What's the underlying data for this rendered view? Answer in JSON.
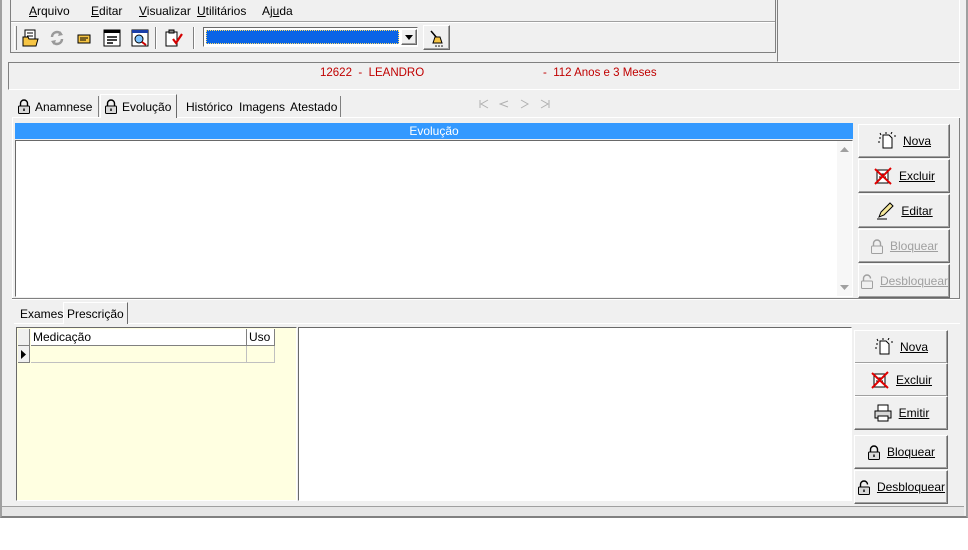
{
  "menu": {
    "items": [
      {
        "label": "Arquivo",
        "u": "A",
        "rest": "rquivo"
      },
      {
        "label": "Editar",
        "u": "E",
        "rest": "ditar"
      },
      {
        "label": "Visualizar",
        "u": "V",
        "rest": "isualizar"
      },
      {
        "label": "Utilitários",
        "u": "U",
        "rest": "tilitários"
      },
      {
        "label": "Ajuda",
        "pre": "Aj",
        "u": "u",
        "rest": "da"
      }
    ]
  },
  "toolbar": {
    "buttons": [
      {
        "name": "open-folder-icon"
      },
      {
        "name": "refresh-icon"
      },
      {
        "name": "card-icon"
      },
      {
        "name": "form-icon"
      },
      {
        "name": "report-icon"
      },
      {
        "name": "checklist-icon"
      }
    ],
    "dropdown_value": "",
    "colors": {
      "dropdown_selected": "#0a64e6"
    }
  },
  "patient": {
    "id_name": "12622  -  LEANDRO",
    "age": "-  112 Anos e 3 Meses",
    "color": "#c00000"
  },
  "tabs": [
    {
      "label": "Anamnese",
      "icon": "lock-icon",
      "active": false
    },
    {
      "label": "Evolução",
      "icon": "lock-icon",
      "active": true
    },
    {
      "label": "Histórico",
      "active": false
    },
    {
      "label": "Imagens",
      "active": false
    },
    {
      "label": "Atestado",
      "active": false
    }
  ],
  "evolucao": {
    "header": "Evolução",
    "header_color": "#3399ff",
    "text": "",
    "buttons": [
      {
        "label": "Nova",
        "icon": "new-document-icon",
        "enabled": true
      },
      {
        "label": "Excluir",
        "icon": "delete-icon",
        "enabled": true
      },
      {
        "label": "Editar",
        "icon": "pencil-icon",
        "enabled": true
      },
      {
        "label": "Bloquear",
        "icon": "lock-icon",
        "enabled": false
      },
      {
        "label": "Desbloquear",
        "icon": "unlock-icon",
        "enabled": false
      }
    ]
  },
  "subtabs": [
    {
      "label": "Exames",
      "active": false
    },
    {
      "label": "Prescrição",
      "active": true
    }
  ],
  "prescricao": {
    "columns": [
      "Medicação",
      "Uso"
    ],
    "rows": [
      [
        "",
        ""
      ]
    ],
    "grid_bg": "#ffffe1",
    "buttons": [
      {
        "label": "Nova",
        "icon": "new-document-icon"
      },
      {
        "label": "Excluir",
        "icon": "delete-icon"
      },
      {
        "label": "Emitir",
        "icon": "printer-icon"
      },
      {
        "label": "Bloquear",
        "icon": "lock-icon"
      },
      {
        "label": "Desbloquear",
        "icon": "unlock-icon"
      }
    ]
  }
}
